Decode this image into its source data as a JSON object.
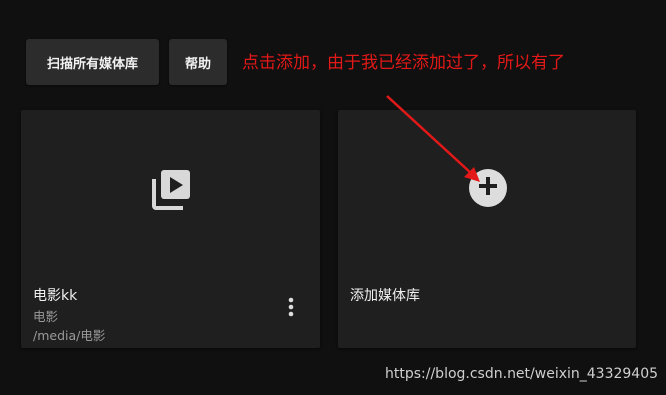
{
  "toolbar": {
    "scan_label": "扫描所有媒体库",
    "help_label": "帮助"
  },
  "annotation": {
    "text": "点击添加，由于我已经添加过了，所以有了",
    "color": "#e31818"
  },
  "libraries": [
    {
      "name": "电影kk",
      "type": "电影",
      "path": "/media/电影",
      "icon": "video-library-icon"
    }
  ],
  "add_card": {
    "label": "添加媒体库",
    "icon": "plus-icon"
  },
  "watermark": {
    "text": "https://blog.csdn.net/weixin_43329405"
  },
  "colors": {
    "background": "#101010",
    "card": "#1f1f1f",
    "button": "#2c2c2c",
    "annotation": "#e31818"
  }
}
